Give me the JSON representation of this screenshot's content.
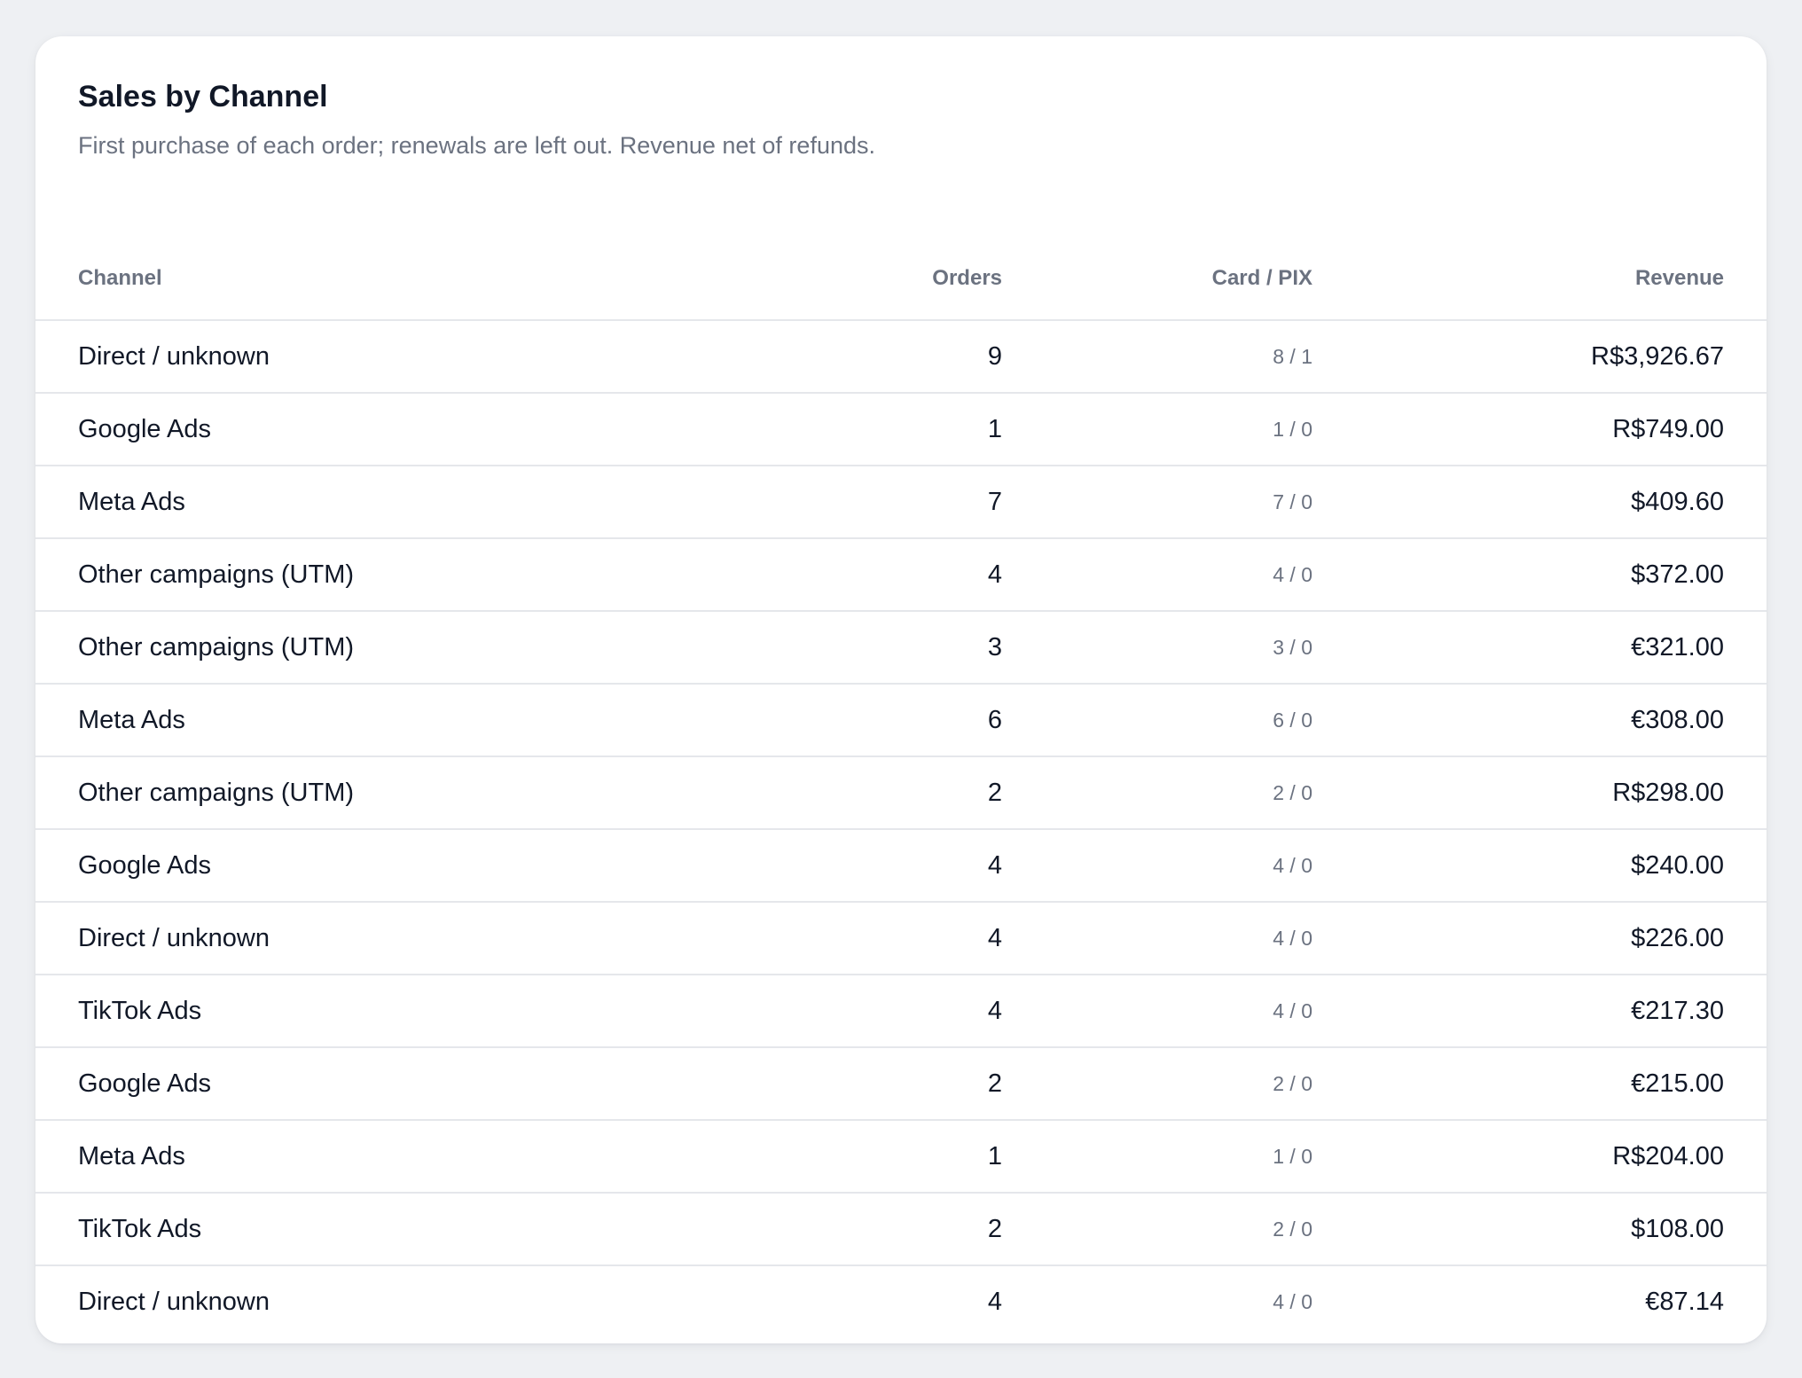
{
  "panel": {
    "title": "Sales by Channel",
    "subtitle": "First purchase of each order; renewals are left out. Revenue net of refunds."
  },
  "table": {
    "columns": [
      "Channel",
      "Orders",
      "Card / PIX",
      "Revenue"
    ],
    "rows": [
      {
        "channel": "Direct / unknown",
        "orders": "9",
        "card_pix": "8 / 1",
        "revenue": "R$3,926.67"
      },
      {
        "channel": "Google Ads",
        "orders": "1",
        "card_pix": "1 / 0",
        "revenue": "R$749.00"
      },
      {
        "channel": "Meta Ads",
        "orders": "7",
        "card_pix": "7 / 0",
        "revenue": "$409.60"
      },
      {
        "channel": "Other campaigns (UTM)",
        "orders": "4",
        "card_pix": "4 / 0",
        "revenue": "$372.00"
      },
      {
        "channel": "Other campaigns (UTM)",
        "orders": "3",
        "card_pix": "3 / 0",
        "revenue": "€321.00"
      },
      {
        "channel": "Meta Ads",
        "orders": "6",
        "card_pix": "6 / 0",
        "revenue": "€308.00"
      },
      {
        "channel": "Other campaigns (UTM)",
        "orders": "2",
        "card_pix": "2 / 0",
        "revenue": "R$298.00"
      },
      {
        "channel": "Google Ads",
        "orders": "4",
        "card_pix": "4 / 0",
        "revenue": "$240.00"
      },
      {
        "channel": "Direct / unknown",
        "orders": "4",
        "card_pix": "4 / 0",
        "revenue": "$226.00"
      },
      {
        "channel": "TikTok Ads",
        "orders": "4",
        "card_pix": "4 / 0",
        "revenue": "€217.30"
      },
      {
        "channel": "Google Ads",
        "orders": "2",
        "card_pix": "2 / 0",
        "revenue": "€215.00"
      },
      {
        "channel": "Meta Ads",
        "orders": "1",
        "card_pix": "1 / 0",
        "revenue": "R$204.00"
      },
      {
        "channel": "TikTok Ads",
        "orders": "2",
        "card_pix": "2 / 0",
        "revenue": "$108.00"
      },
      {
        "channel": "Direct / unknown",
        "orders": "4",
        "card_pix": "4 / 0",
        "revenue": "€87.14"
      }
    ]
  },
  "colors": {
    "background": "#eef0f3",
    "card": "#ffffff",
    "text_primary": "#111827",
    "text_muted": "#6b7280",
    "divider": "#e5e7eb"
  }
}
